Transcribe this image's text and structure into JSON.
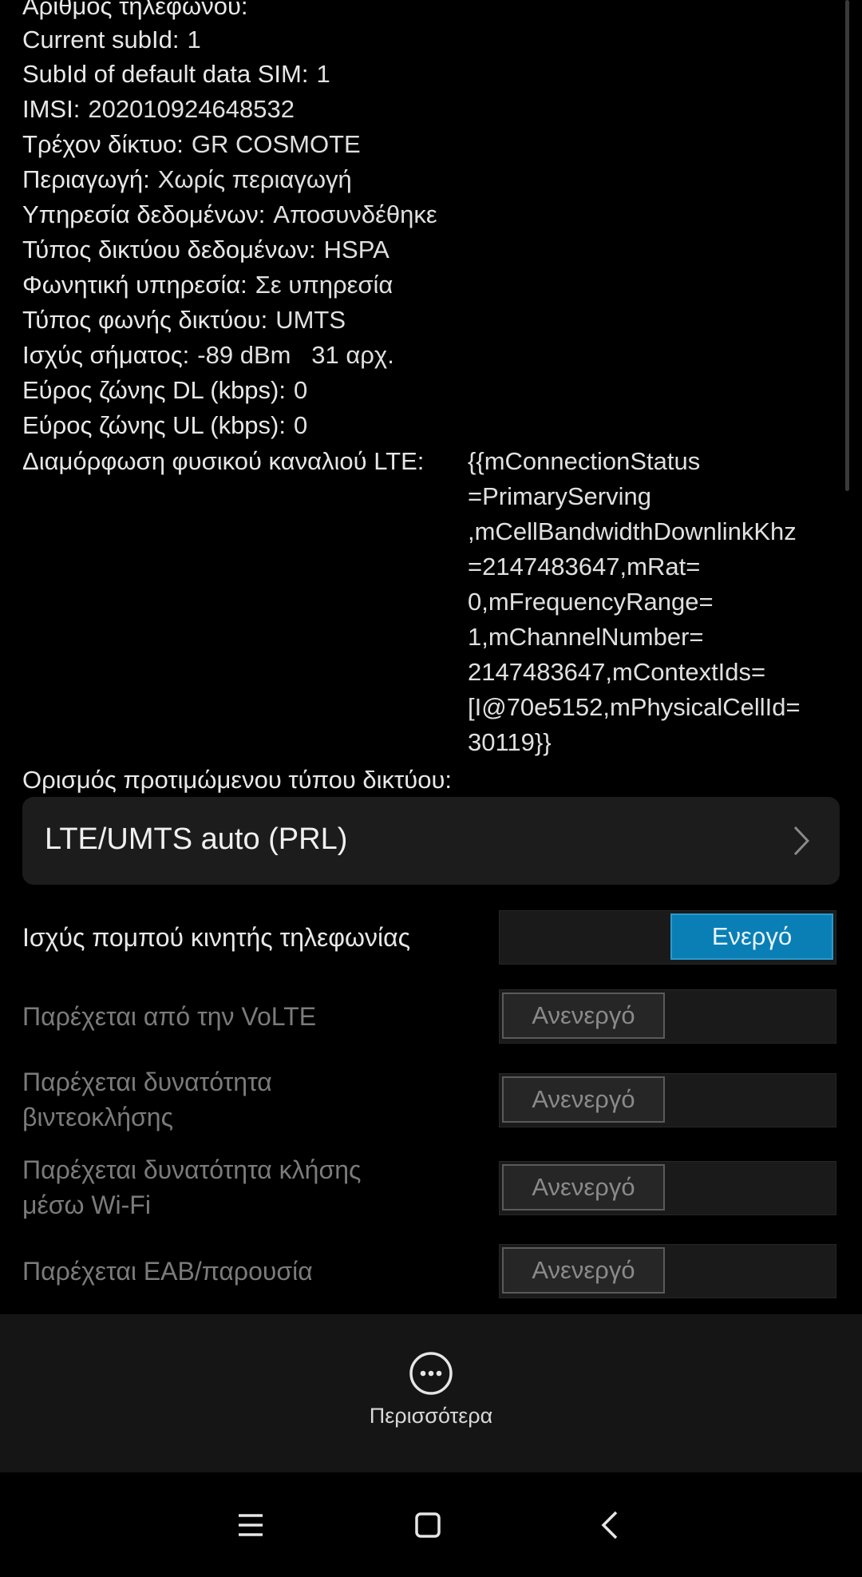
{
  "info_rows": [
    {
      "key": "Αριθμός τηλεφώνου:",
      "value": ""
    },
    {
      "key": "Current subId:",
      "value": "1"
    },
    {
      "key": "SubId of default data SIM:",
      "value": "1"
    },
    {
      "key": "IMSI:",
      "value": "202010924648532"
    },
    {
      "key": "Τρέχον δίκτυο:",
      "value": "GR COSMOTE"
    },
    {
      "key": "Περιαγωγή:",
      "value": "Χωρίς περιαγωγή"
    },
    {
      "key": "Υπηρεσία δεδομένων:",
      "value": "Αποσυνδέθηκε"
    },
    {
      "key": "Τύπος δικτύου δεδομένων:",
      "value": "HSPA"
    },
    {
      "key": "Φωνητική υπηρεσία:",
      "value": "Σε υπηρεσία"
    },
    {
      "key": "Τύπος φωνής δικτύου:",
      "value": "UMTS"
    },
    {
      "key": "Ισχύς σήματος:",
      "value": "-89 dBm   31 αρχ."
    },
    {
      "key": "Εύρος ζώνης DL (kbps):",
      "value": "0"
    },
    {
      "key": "Εύρος ζώνης UL (kbps):",
      "value": "0"
    }
  ],
  "lte_config": {
    "key": "Διαμόρφωση φυσικού καναλιού LTE:",
    "lines": [
      "{{mConnectionStatus",
      "=PrimaryServing",
      ",mCellBandwidthDownlinkKhz",
      "=2147483647,mRat=",
      "0,mFrequencyRange=",
      "1,mChannelNumber=",
      "2147483647,mContextIds=",
      "[I@70e5152,mPhysicalCellId=",
      "30119}}"
    ]
  },
  "preferred_network": {
    "label": "Ορισμός προτιμώμενου τύπου δικτύου:",
    "value": "LTE/UMTS auto (PRL)"
  },
  "toggles": [
    {
      "label": "Ισχύς πομπού κινητής τηλεφωνίας",
      "state": "Ενεργό",
      "on": true
    },
    {
      "label": "Παρέχεται από την VoLTE",
      "state": "Ανενεργό",
      "on": false
    },
    {
      "label": "Παρέχεται δυνατότητα βιντεοκλήσης",
      "state": "Ανενεργό",
      "on": false
    },
    {
      "label": "Παρέχεται δυνατότητα κλήσης μέσω Wi-Fi",
      "state": "Ανενεργό",
      "on": false
    },
    {
      "label": "Παρέχεται EAB/παρουσία",
      "state": "Ανενεργό",
      "on": false
    }
  ],
  "bottom": {
    "more_label": "Περισσότερα"
  },
  "colors": {
    "accent": "#0a7fb6",
    "background": "#000000",
    "panel": "#1c1c1c"
  },
  "nav": {
    "icons": [
      "menu-icon",
      "home-icon",
      "back-icon"
    ]
  }
}
